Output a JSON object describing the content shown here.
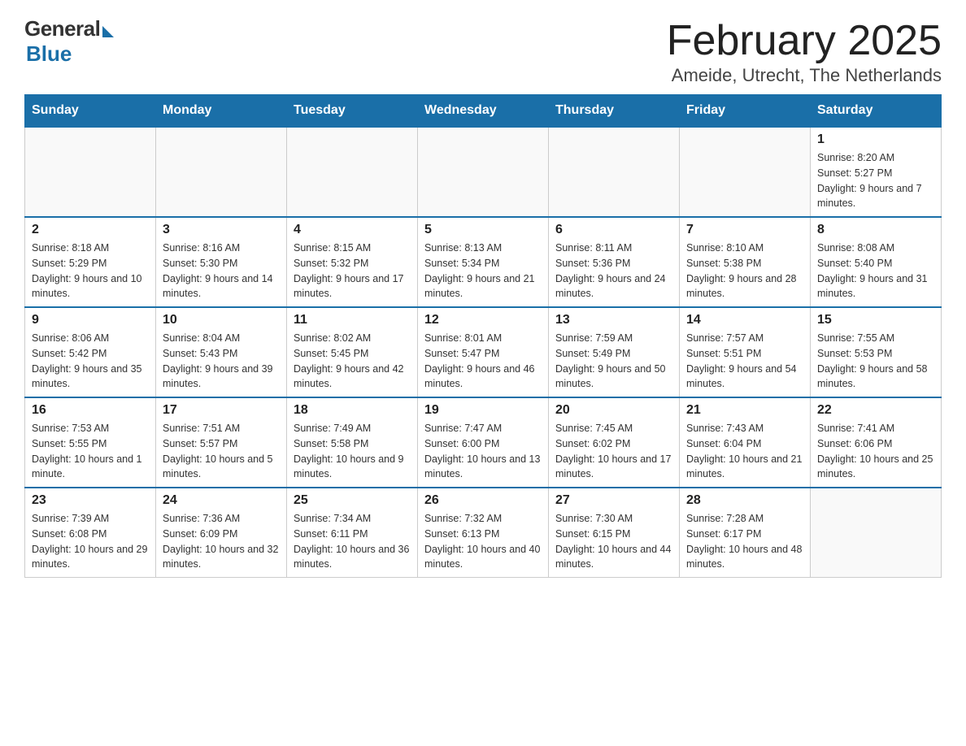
{
  "header": {
    "logo_general": "General",
    "logo_blue": "Blue",
    "month_title": "February 2025",
    "location": "Ameide, Utrecht, The Netherlands"
  },
  "days_of_week": [
    "Sunday",
    "Monday",
    "Tuesday",
    "Wednesday",
    "Thursday",
    "Friday",
    "Saturday"
  ],
  "weeks": [
    [
      {
        "day": "",
        "info": ""
      },
      {
        "day": "",
        "info": ""
      },
      {
        "day": "",
        "info": ""
      },
      {
        "day": "",
        "info": ""
      },
      {
        "day": "",
        "info": ""
      },
      {
        "day": "",
        "info": ""
      },
      {
        "day": "1",
        "info": "Sunrise: 8:20 AM\nSunset: 5:27 PM\nDaylight: 9 hours and 7 minutes."
      }
    ],
    [
      {
        "day": "2",
        "info": "Sunrise: 8:18 AM\nSunset: 5:29 PM\nDaylight: 9 hours and 10 minutes."
      },
      {
        "day": "3",
        "info": "Sunrise: 8:16 AM\nSunset: 5:30 PM\nDaylight: 9 hours and 14 minutes."
      },
      {
        "day": "4",
        "info": "Sunrise: 8:15 AM\nSunset: 5:32 PM\nDaylight: 9 hours and 17 minutes."
      },
      {
        "day": "5",
        "info": "Sunrise: 8:13 AM\nSunset: 5:34 PM\nDaylight: 9 hours and 21 minutes."
      },
      {
        "day": "6",
        "info": "Sunrise: 8:11 AM\nSunset: 5:36 PM\nDaylight: 9 hours and 24 minutes."
      },
      {
        "day": "7",
        "info": "Sunrise: 8:10 AM\nSunset: 5:38 PM\nDaylight: 9 hours and 28 minutes."
      },
      {
        "day": "8",
        "info": "Sunrise: 8:08 AM\nSunset: 5:40 PM\nDaylight: 9 hours and 31 minutes."
      }
    ],
    [
      {
        "day": "9",
        "info": "Sunrise: 8:06 AM\nSunset: 5:42 PM\nDaylight: 9 hours and 35 minutes."
      },
      {
        "day": "10",
        "info": "Sunrise: 8:04 AM\nSunset: 5:43 PM\nDaylight: 9 hours and 39 minutes."
      },
      {
        "day": "11",
        "info": "Sunrise: 8:02 AM\nSunset: 5:45 PM\nDaylight: 9 hours and 42 minutes."
      },
      {
        "day": "12",
        "info": "Sunrise: 8:01 AM\nSunset: 5:47 PM\nDaylight: 9 hours and 46 minutes."
      },
      {
        "day": "13",
        "info": "Sunrise: 7:59 AM\nSunset: 5:49 PM\nDaylight: 9 hours and 50 minutes."
      },
      {
        "day": "14",
        "info": "Sunrise: 7:57 AM\nSunset: 5:51 PM\nDaylight: 9 hours and 54 minutes."
      },
      {
        "day": "15",
        "info": "Sunrise: 7:55 AM\nSunset: 5:53 PM\nDaylight: 9 hours and 58 minutes."
      }
    ],
    [
      {
        "day": "16",
        "info": "Sunrise: 7:53 AM\nSunset: 5:55 PM\nDaylight: 10 hours and 1 minute."
      },
      {
        "day": "17",
        "info": "Sunrise: 7:51 AM\nSunset: 5:57 PM\nDaylight: 10 hours and 5 minutes."
      },
      {
        "day": "18",
        "info": "Sunrise: 7:49 AM\nSunset: 5:58 PM\nDaylight: 10 hours and 9 minutes."
      },
      {
        "day": "19",
        "info": "Sunrise: 7:47 AM\nSunset: 6:00 PM\nDaylight: 10 hours and 13 minutes."
      },
      {
        "day": "20",
        "info": "Sunrise: 7:45 AM\nSunset: 6:02 PM\nDaylight: 10 hours and 17 minutes."
      },
      {
        "day": "21",
        "info": "Sunrise: 7:43 AM\nSunset: 6:04 PM\nDaylight: 10 hours and 21 minutes."
      },
      {
        "day": "22",
        "info": "Sunrise: 7:41 AM\nSunset: 6:06 PM\nDaylight: 10 hours and 25 minutes."
      }
    ],
    [
      {
        "day": "23",
        "info": "Sunrise: 7:39 AM\nSunset: 6:08 PM\nDaylight: 10 hours and 29 minutes."
      },
      {
        "day": "24",
        "info": "Sunrise: 7:36 AM\nSunset: 6:09 PM\nDaylight: 10 hours and 32 minutes."
      },
      {
        "day": "25",
        "info": "Sunrise: 7:34 AM\nSunset: 6:11 PM\nDaylight: 10 hours and 36 minutes."
      },
      {
        "day": "26",
        "info": "Sunrise: 7:32 AM\nSunset: 6:13 PM\nDaylight: 10 hours and 40 minutes."
      },
      {
        "day": "27",
        "info": "Sunrise: 7:30 AM\nSunset: 6:15 PM\nDaylight: 10 hours and 44 minutes."
      },
      {
        "day": "28",
        "info": "Sunrise: 7:28 AM\nSunset: 6:17 PM\nDaylight: 10 hours and 48 minutes."
      },
      {
        "day": "",
        "info": ""
      }
    ]
  ]
}
